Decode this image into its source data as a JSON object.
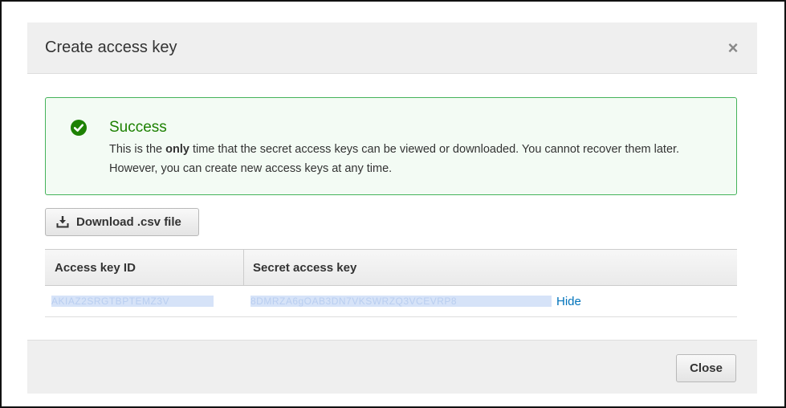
{
  "modal": {
    "title": "Create access key",
    "close_icon": "close-icon",
    "close_glyph": "×"
  },
  "alert": {
    "icon": "check-circle-icon",
    "title": "Success",
    "body_before": "This is the ",
    "body_bold": "only",
    "body_after": " time that the secret access keys can be viewed or downloaded. You cannot recover them later. However, you can create new access keys at any time.",
    "color": "#1d8102",
    "border_color": "#44b35a"
  },
  "download": {
    "icon": "download-icon",
    "label": "Download .csv file"
  },
  "table": {
    "headers": [
      "Access key ID",
      "Secret access key"
    ],
    "row": {
      "access_key_id": "AKIAZ2SRGTBPTEMZ3V",
      "secret_access_key": "8DMRZA6gOAB3DN7VKSWRZQ3VCEVRP8",
      "hide_label": "Hide"
    }
  },
  "footer": {
    "close_label": "Close"
  },
  "colors": {
    "link": "#0073bb",
    "header_bg": "#efefef"
  }
}
